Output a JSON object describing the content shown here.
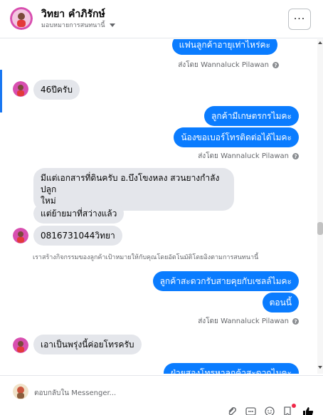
{
  "header": {
    "contact_name": "วิทยา คำภิรักษ์",
    "subtitle": "มอบหมายการสนทนานี้",
    "more_label": "···"
  },
  "messages": [
    {
      "side": "out",
      "text": "แฟนลูกค้าอายุเท่าไหร่คะ"
    },
    {
      "side": "sent_by",
      "text": "ส่งโดย Wannaluck Pilawan"
    },
    {
      "side": "in",
      "text": "46ปีครับ"
    },
    {
      "side": "out",
      "text": "ลูกค้ามีเกษตรกรไมคะ"
    },
    {
      "side": "out",
      "text": "น้องขอเบอร์โทรติดต่อได้ไมคะ"
    },
    {
      "side": "sent_by",
      "text": "ส่งโดย Wannaluck Pilawan"
    },
    {
      "side": "in",
      "text_line1": "มีแต่เอกสารที่ดินครับ อ.บึงโขงหลง สวนยางกำลังปลูก",
      "text_line2": "ใหม่"
    },
    {
      "side": "in",
      "text": "แต่ย้ายมาที่สว่างแล้ว"
    },
    {
      "side": "in",
      "text": "0816731044วิทยา"
    },
    {
      "side": "system",
      "text": "เราสร้างกิจกรรมของลูกค้าเป้าหมายให้กับคุณโดยอัตโนมัติโดยอิงตามการสนทนานี้"
    },
    {
      "side": "out",
      "text": "ลูกค้าสะดวกรับสายคุยกับเซลล์ไมคะ"
    },
    {
      "side": "out",
      "text": "ตอนนี้"
    },
    {
      "side": "sent_by",
      "text": "ส่งโดย Wannaluck Pilawan"
    },
    {
      "side": "in",
      "text": "เอาเป็นพรุ่งนี้ค่อยโทรครับ"
    },
    {
      "side": "out",
      "text": "ฝ่ายสองโทรหาลูกค้าสะดวกไมคะ"
    }
  ],
  "composer": {
    "placeholder": "ตอบกลับใน Messenger..."
  },
  "colors": {
    "outgoing_bubble": "#0a7cff",
    "incoming_bubble": "#e4e6eb",
    "accent": "#1877f2"
  },
  "icons": [
    "more-options-icon",
    "chevron-down-icon",
    "info-icon",
    "attachment-icon",
    "quick-reply-icon",
    "emoji-icon",
    "saved-reply-icon",
    "like-icon"
  ]
}
